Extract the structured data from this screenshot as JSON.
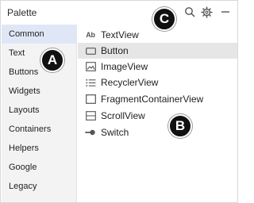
{
  "panel": {
    "title": "Palette"
  },
  "header_icons": [
    "search-icon",
    "gear-icon",
    "minimize-icon"
  ],
  "categories": [
    {
      "label": "Common",
      "selected": true
    },
    {
      "label": "Text",
      "selected": false
    },
    {
      "label": "Buttons",
      "selected": false
    },
    {
      "label": "Widgets",
      "selected": false
    },
    {
      "label": "Layouts",
      "selected": false
    },
    {
      "label": "Containers",
      "selected": false
    },
    {
      "label": "Helpers",
      "selected": false
    },
    {
      "label": "Google",
      "selected": false
    },
    {
      "label": "Legacy",
      "selected": false
    }
  ],
  "widgets": [
    {
      "label": "TextView",
      "icon": "text-ab-icon",
      "icon_text": "Ab",
      "selected": false
    },
    {
      "label": "Button",
      "icon": "button-icon",
      "selected": true
    },
    {
      "label": "ImageView",
      "icon": "image-icon",
      "selected": false
    },
    {
      "label": "RecyclerView",
      "icon": "list-icon",
      "selected": false
    },
    {
      "label": "FragmentContainerView",
      "icon": "container-icon",
      "selected": false
    },
    {
      "label": "ScrollView",
      "icon": "scroll-icon",
      "selected": false
    },
    {
      "label": "Switch",
      "icon": "switch-icon",
      "selected": false
    }
  ],
  "callouts": {
    "a": "A",
    "b": "B",
    "c": "C"
  },
  "colors": {
    "selected_category_bg": "#dfe7f7",
    "selected_item_bg": "#e6e6e6",
    "sidebar_bg": "#f3f3f3",
    "badge_bg": "#111111"
  }
}
